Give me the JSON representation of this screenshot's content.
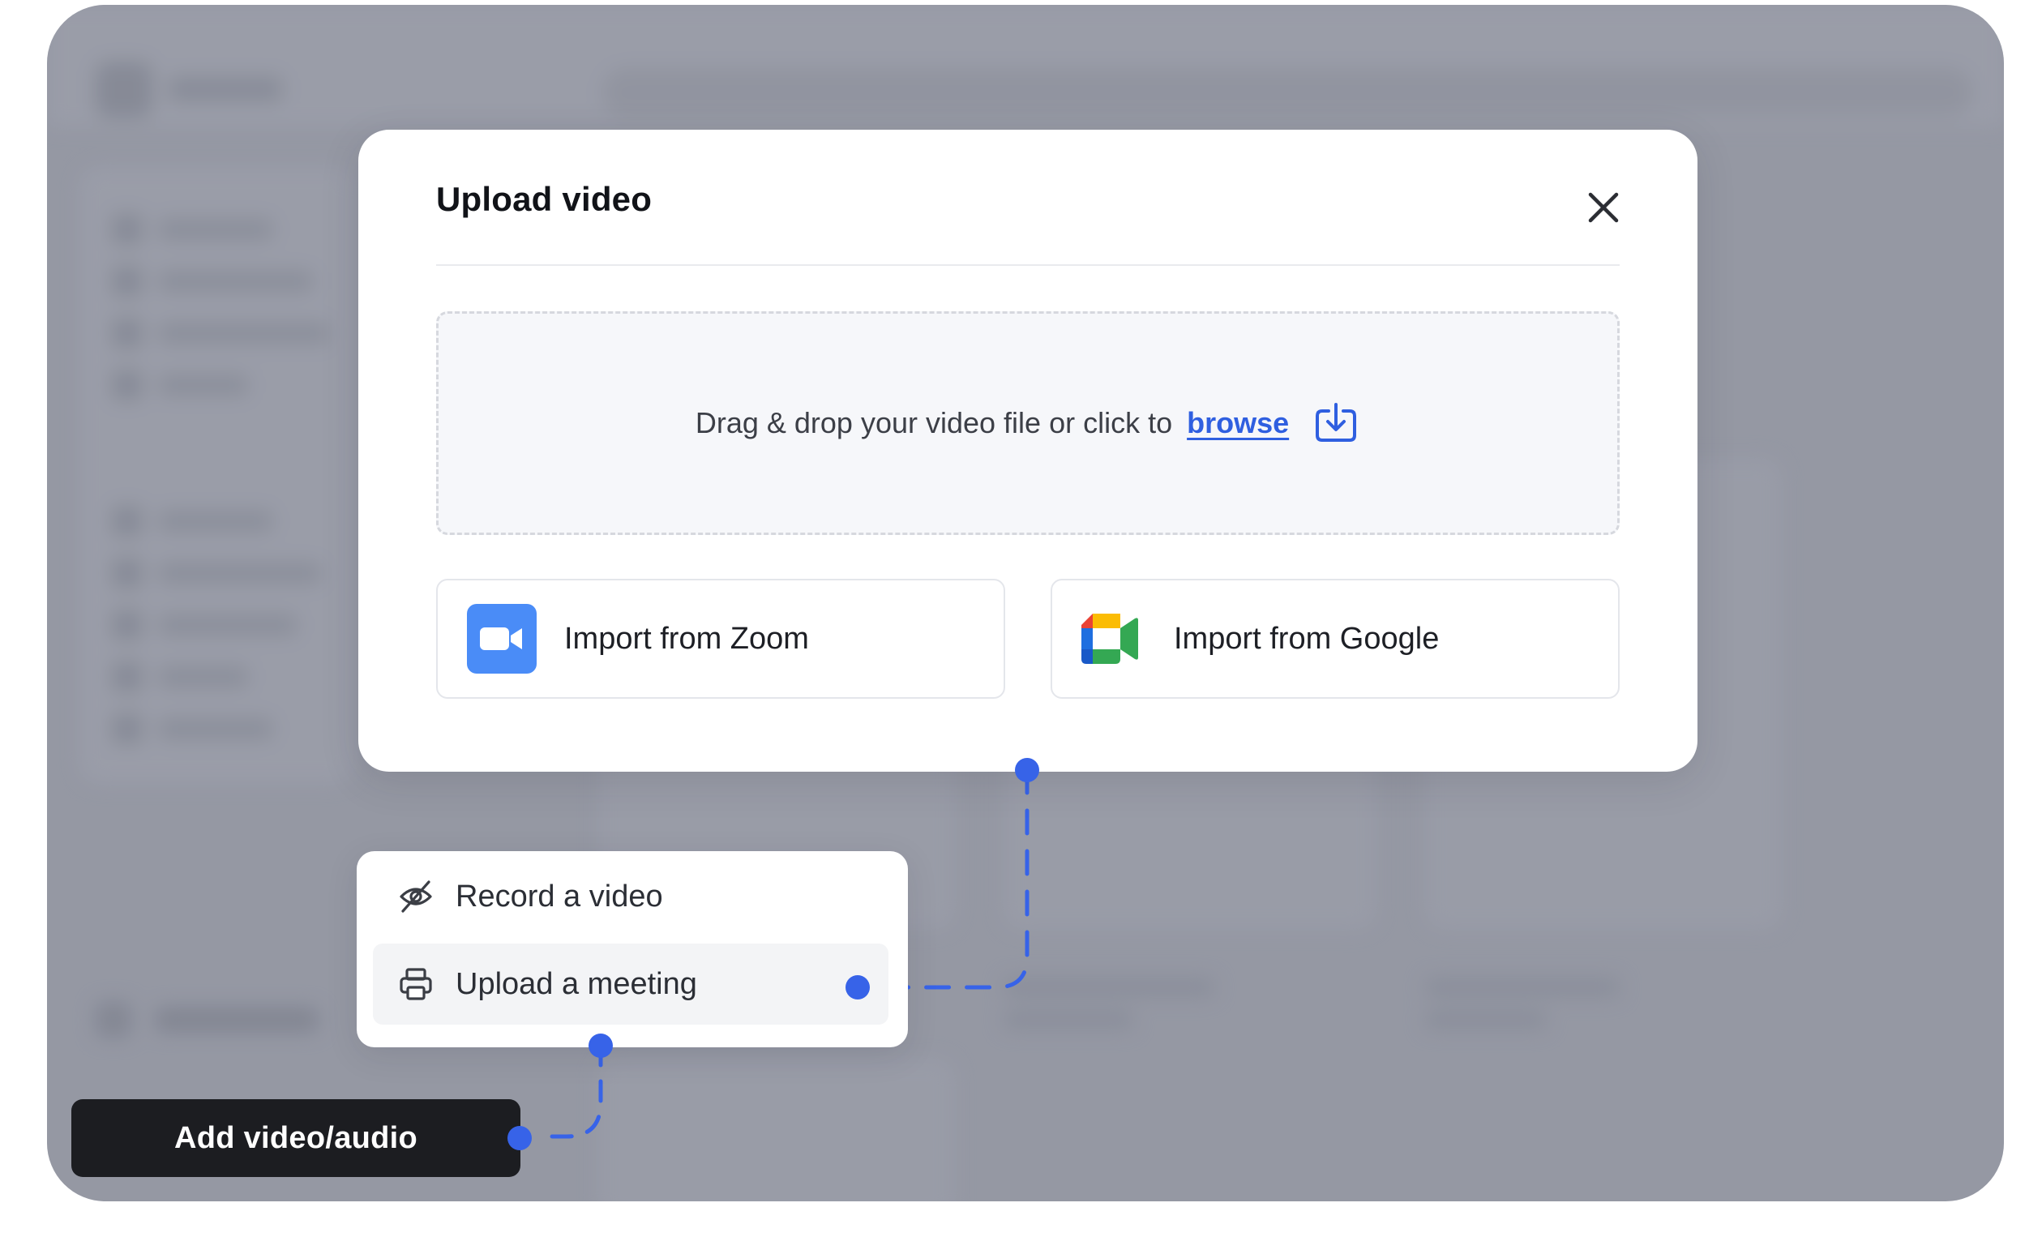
{
  "modal": {
    "title": "Upload video",
    "dropzone_text": "Drag & drop your video file or click to",
    "browse_label": "browse",
    "import_buttons": [
      {
        "label": "Import from Zoom",
        "icon": "zoom-logo-icon"
      },
      {
        "label": "Import from Google",
        "icon": "google-meet-logo-icon"
      }
    ],
    "close_icon": "close-icon",
    "upload_icon": "download-tray-icon"
  },
  "menu": {
    "items": [
      {
        "label": "Record a video",
        "icon": "eye-slash-icon"
      },
      {
        "label": "Upload a meeting",
        "icon": "printer-icon"
      }
    ]
  },
  "add_button": {
    "label": "Add video/audio"
  },
  "colors": {
    "accent": "#3763e8",
    "link": "#2f5fe0",
    "dark_button": "#1c1d21",
    "zoom_blue": "#4a8cf7"
  }
}
